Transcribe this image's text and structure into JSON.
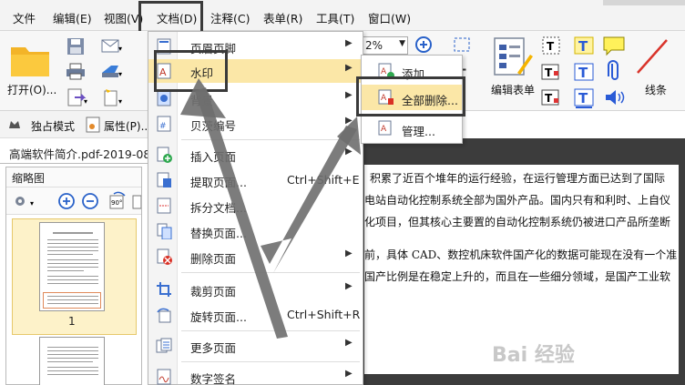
{
  "menubar": {
    "items": [
      "文件",
      "编辑(E)",
      "视图(V)",
      "文档(D)",
      "注释(C)",
      "表单(R)",
      "工具(T)",
      "窗口(W)"
    ]
  },
  "ribbon": {
    "open_label": "打开(O)...",
    "zoom_value": "2%",
    "edit_form_label": "编辑表单",
    "lines_label": "线条"
  },
  "modebar": {
    "exclusive_mode": "独占模式",
    "properties": "属性(P)..."
  },
  "document_tab": {
    "title": "高端软件简介.pdf-2019-08-"
  },
  "thumbnails": {
    "title": "缩略图",
    "page1_number": "1"
  },
  "document_text": {
    "lines": [
      "积累了近百个堆年的运行经验，在运行管理方面已达到了国际",
      "电站自动化控制系统全部为国外产品。国内只有和利时、上自仪",
      "化项目，但其核心主要置的自动化控制系统仍被进口产品所垄断",
      "前，具体 CAD、数控机床软件国产化的数据可能现在没有一个准",
      "国产比例是在稳定上升的，而且在一些细分领域，是国产工业软"
    ]
  },
  "document_menu": {
    "items": [
      {
        "label": "页眉页脚",
        "shortcut": "",
        "submenu": true
      },
      {
        "label": "水印",
        "shortcut": "",
        "submenu": true
      },
      {
        "label": "背景",
        "shortcut": "",
        "submenu": true
      },
      {
        "label": "贝茨编号",
        "shortcut": "",
        "submenu": true
      },
      {
        "label": "插入页面",
        "shortcut": "",
        "submenu": true
      },
      {
        "label": "提取页面...",
        "shortcut": "Ctrl+Shift+E",
        "submenu": false
      },
      {
        "label": "拆分文档...",
        "shortcut": "",
        "submenu": false
      },
      {
        "label": "替换页面...",
        "shortcut": "",
        "submenu": false
      },
      {
        "label": "删除页面",
        "shortcut": "",
        "submenu": true
      },
      {
        "label": "裁剪页面",
        "shortcut": "",
        "submenu": true
      },
      {
        "label": "旋转页面...",
        "shortcut": "Ctrl+Shift+R",
        "submenu": false
      },
      {
        "label": "更多页面",
        "shortcut": "",
        "submenu": true
      },
      {
        "label": "数字签名",
        "shortcut": "",
        "submenu": true
      }
    ]
  },
  "watermark_submenu": {
    "items": [
      "添加...",
      "全部删除...",
      "管理..."
    ]
  },
  "thumb_zoom_labels": [
    "90°",
    "90°"
  ],
  "watermark": "Bai 经验",
  "colors": {
    "menu_highlight": "#fbe7a7",
    "highlight_border": "#333333",
    "doc_bg": "#3c3c3c"
  }
}
